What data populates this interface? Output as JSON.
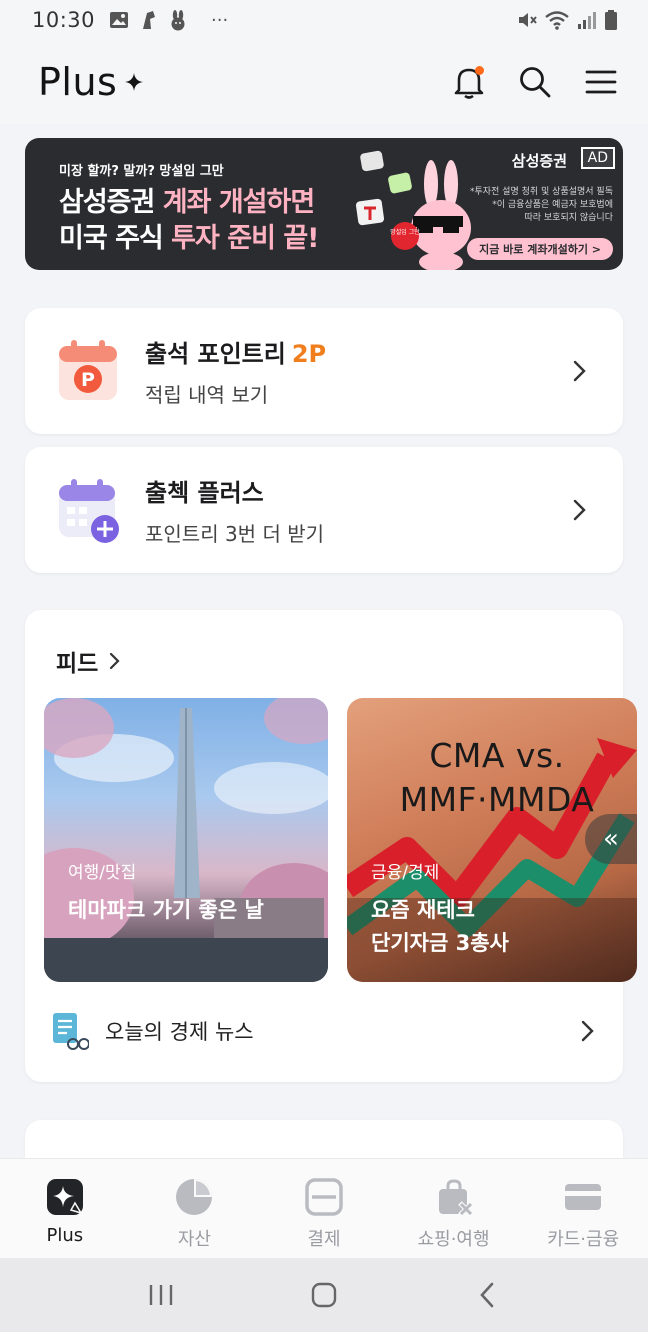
{
  "status_bar": {
    "time": "10:30",
    "overflow": "···"
  },
  "header": {
    "logo": "Plus"
  },
  "ad": {
    "small_text": "미장 할까? 말까? 망설임 그만",
    "line1_a": "삼성증권 ",
    "line1_b": "계좌 개설하면",
    "line2_a": "미국 주식 ",
    "line2_b": "투자 준비 끝!",
    "brand": "삼성증권",
    "tag": "AD",
    "disclaimer_1": "*투자전 설명 청취 및 상품설명서 필독",
    "disclaimer_2": "*이 금융상품은 예금자 보호법에",
    "disclaimer_3": "따라 보호되지 않습니다",
    "cta": "지금 바로 계좌개설하기 >",
    "sticker": "망설임 그만"
  },
  "attendance": {
    "title": "출석 포인트리",
    "points": "2P",
    "subtitle": "적립 내역 보기"
  },
  "check_plus": {
    "title": "출첵 플러스",
    "subtitle": "포인트리 3번 더 받기"
  },
  "feed": {
    "title": "피드",
    "items": [
      {
        "category": "여행/맛집",
        "title": "테마파크 가기 좋은 날"
      },
      {
        "category": "금융/경제",
        "title_line1": "요즘 재테크",
        "title_line2": "단기자금 3총사",
        "image_text_1": "CMA vs.",
        "image_text_2": "MMF·MMDA"
      }
    ],
    "scroll_tab": "«",
    "news": "오늘의 경제 뉴스"
  },
  "bottom_nav": [
    {
      "label": "Plus",
      "icon": "plus-spark-icon"
    },
    {
      "label": "자산",
      "icon": "pie-chart-icon"
    },
    {
      "label": "결제",
      "icon": "scan-pay-icon"
    },
    {
      "label": "쇼핑·여행",
      "icon": "shopping-bag-icon"
    },
    {
      "label": "카드·금융",
      "icon": "credit-card-icon"
    }
  ],
  "colors": {
    "accent_orange": "#f07e1c",
    "notification_dot": "#ff6b1a",
    "ad_background": "#2a2c30",
    "ad_highlight": "#ffb3c2"
  }
}
